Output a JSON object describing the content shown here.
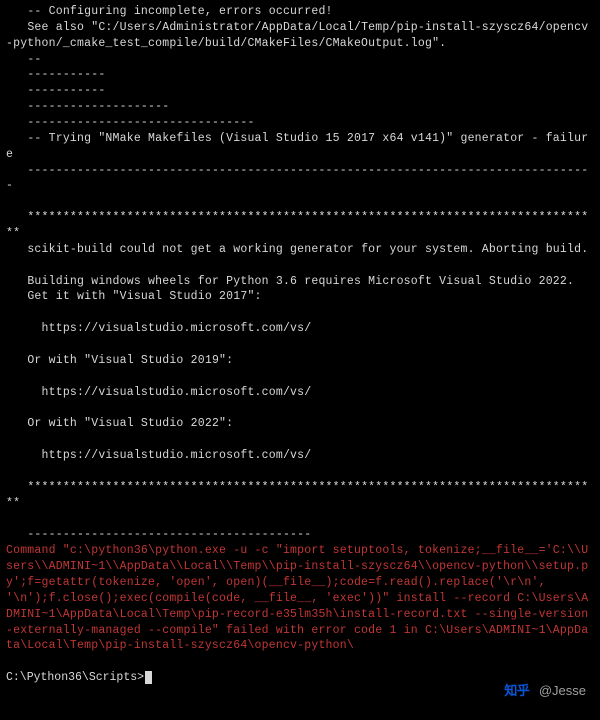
{
  "terminal": {
    "lines": [
      {
        "cls": "gray",
        "text": "   -- Configuring incomplete, errors occurred!"
      },
      {
        "cls": "gray",
        "text": "   See also \"C:/Users/Administrator/AppData/Local/Temp/pip-install-szyscz64/opencv-python/_cmake_test_compile/build/CMakeFiles/CMakeOutput.log\"."
      },
      {
        "cls": "gray",
        "text": "   --"
      },
      {
        "cls": "gray",
        "text": "   -----------"
      },
      {
        "cls": "gray",
        "text": "   -----------"
      },
      {
        "cls": "gray",
        "text": "   --------------------"
      },
      {
        "cls": "gray",
        "text": "   --------------------------------"
      },
      {
        "cls": "gray",
        "text": "   -- Trying \"NMake Makefiles (Visual Studio 15 2017 x64 v141)\" generator - failure"
      },
      {
        "cls": "gray",
        "text": "   --------------------------------------------------------------------------------"
      },
      {
        "cls": "gray",
        "text": ""
      },
      {
        "cls": "gray",
        "text": "   *********************************************************************************"
      },
      {
        "cls": "gray",
        "text": "   scikit-build could not get a working generator for your system. Aborting build."
      },
      {
        "cls": "gray",
        "text": ""
      },
      {
        "cls": "gray",
        "text": "   Building windows wheels for Python 3.6 requires Microsoft Visual Studio 2022."
      },
      {
        "cls": "gray",
        "text": "   Get it with \"Visual Studio 2017\":"
      },
      {
        "cls": "gray",
        "text": ""
      },
      {
        "cls": "gray",
        "text": "     https://visualstudio.microsoft.com/vs/"
      },
      {
        "cls": "gray",
        "text": ""
      },
      {
        "cls": "gray",
        "text": "   Or with \"Visual Studio 2019\":"
      },
      {
        "cls": "gray",
        "text": ""
      },
      {
        "cls": "gray",
        "text": "     https://visualstudio.microsoft.com/vs/"
      },
      {
        "cls": "gray",
        "text": ""
      },
      {
        "cls": "gray",
        "text": "   Or with \"Visual Studio 2022\":"
      },
      {
        "cls": "gray",
        "text": ""
      },
      {
        "cls": "gray",
        "text": "     https://visualstudio.microsoft.com/vs/"
      },
      {
        "cls": "gray",
        "text": ""
      },
      {
        "cls": "gray",
        "text": "   *********************************************************************************"
      },
      {
        "cls": "gray",
        "text": ""
      },
      {
        "cls": "gray",
        "text": "   ----------------------------------------"
      },
      {
        "cls": "red",
        "text": "Command \"c:\\python36\\python.exe -u -c \"import setuptools, tokenize;__file__='C:\\\\Users\\\\ADMINI~1\\\\AppData\\\\Local\\\\Temp\\\\pip-install-szyscz64\\\\opencv-python\\\\setup.py';f=getattr(tokenize, 'open', open)(__file__);code=f.read().replace('\\r\\n', '\\n');f.close();exec(compile(code, __file__, 'exec'))\" install --record C:\\Users\\ADMINI~1\\AppData\\Local\\Temp\\pip-record-e35lm35h\\install-record.txt --single-version-externally-managed --compile\" failed with error code 1 in C:\\Users\\ADMINI~1\\AppData\\Local\\Temp\\pip-install-szyscz64\\opencv-python\\"
      },
      {
        "cls": "gray",
        "text": ""
      }
    ],
    "prompt": "C:\\Python36\\Scripts>"
  },
  "watermark": {
    "logo_text": "知乎",
    "author": "@Jesse"
  }
}
